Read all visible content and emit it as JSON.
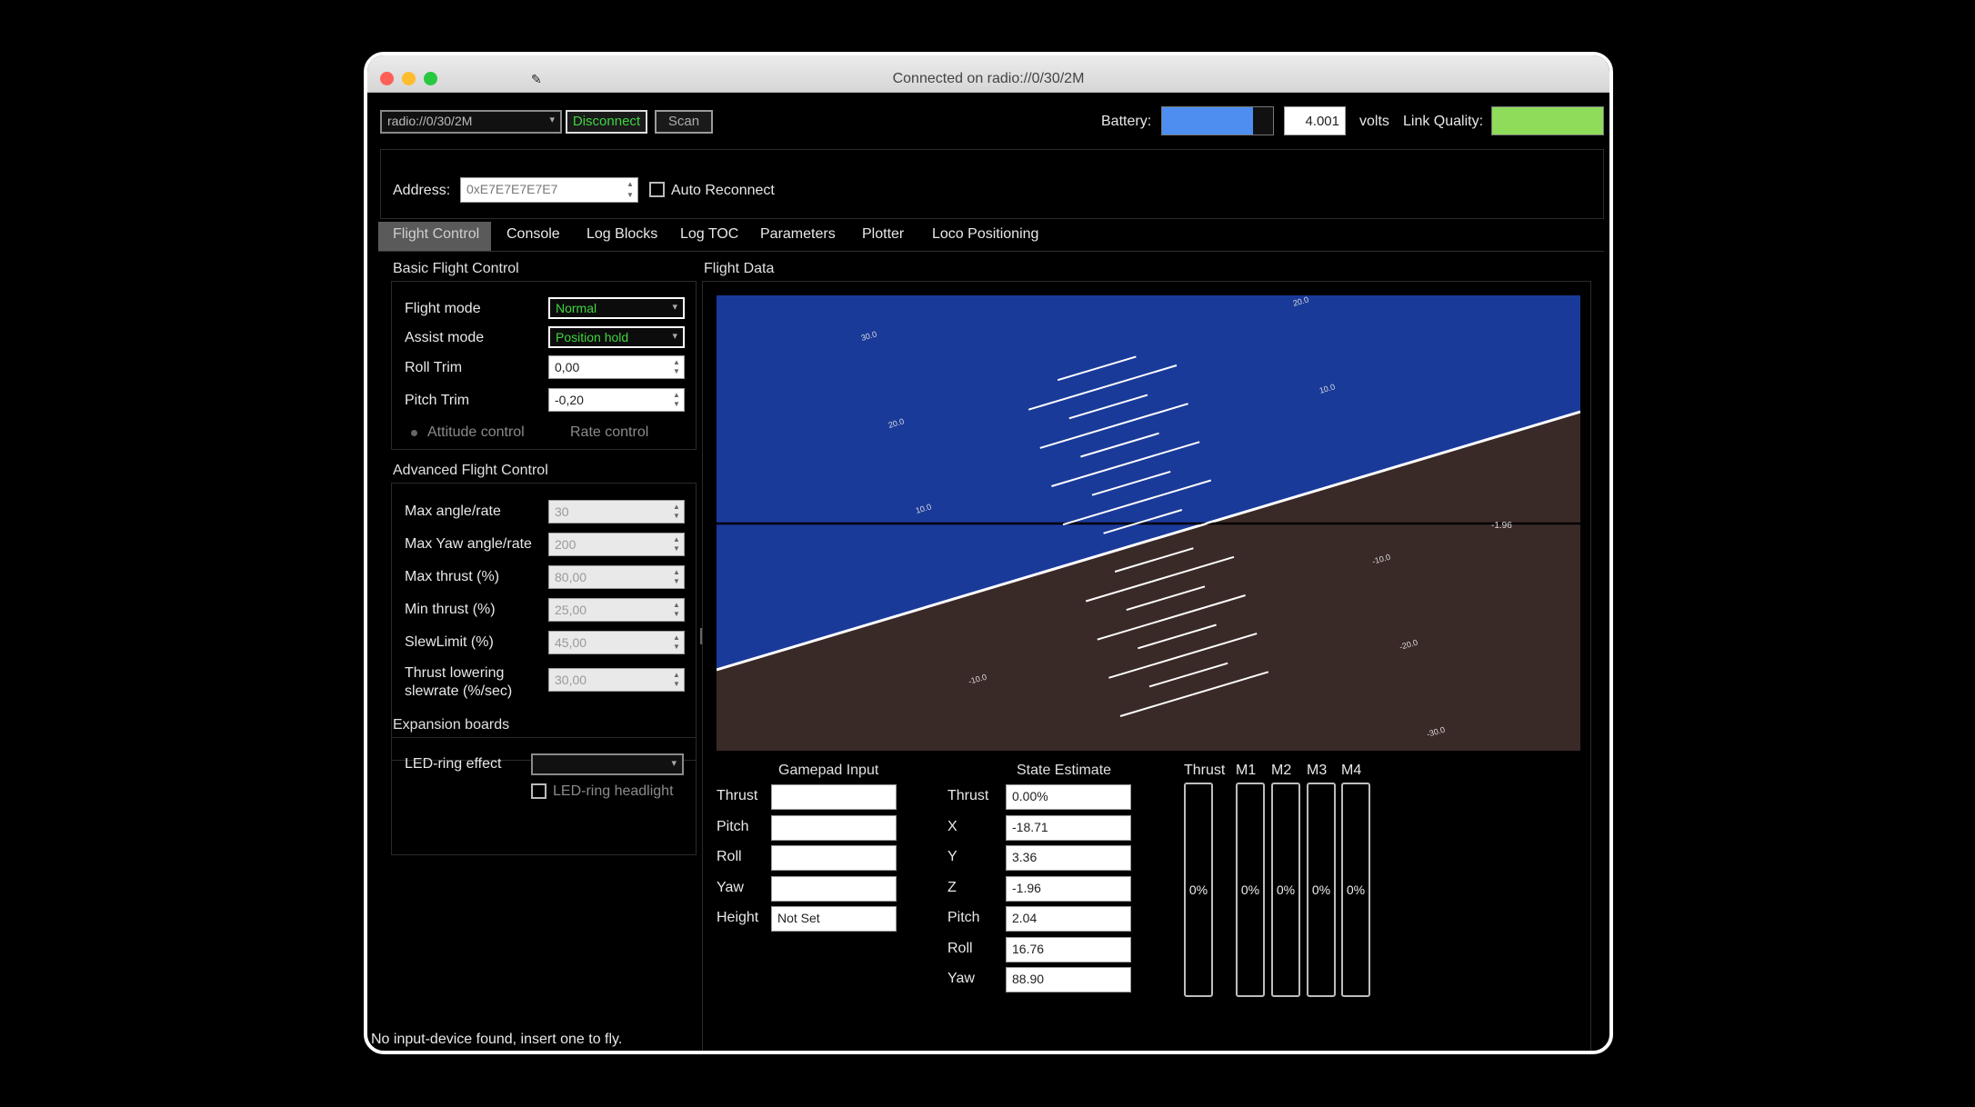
{
  "window": {
    "title": "Connected on radio://0/30/2M"
  },
  "toolbar": {
    "uri_value": "radio://0/30/2M",
    "disconnect_label": "Disconnect",
    "scan_label": "Scan",
    "battery_label": "Battery:",
    "battery_level": 0.82,
    "battery_value": "4.001",
    "volts_label": "volts",
    "link_quality_label": "Link Quality:",
    "link_quality_level": 1.0
  },
  "address": {
    "label": "Address:",
    "value": "0xE7E7E7E7E7",
    "auto_reconnect_label": "Auto Reconnect"
  },
  "tabs": [
    "Flight Control",
    "Console",
    "Log Blocks",
    "Log TOC",
    "Parameters",
    "Plotter",
    "Loco Positioning"
  ],
  "basic": {
    "title": "Basic Flight Control",
    "flight_mode_label": "Flight mode",
    "flight_mode_value": "Normal",
    "assist_mode_label": "Assist mode",
    "assist_mode_value": "Position hold",
    "roll_trim_label": "Roll Trim",
    "roll_trim_value": "0,00",
    "pitch_trim_label": "Pitch Trim",
    "pitch_trim_value": "-0,20",
    "attitude_label": "Attitude control",
    "rate_label": "Rate control"
  },
  "advanced": {
    "title": "Advanced Flight Control",
    "rows": [
      {
        "label": "Max angle/rate",
        "value": "30"
      },
      {
        "label": "Max Yaw angle/rate",
        "value": "200"
      },
      {
        "label": "Max thrust (%)",
        "value": "80,00"
      },
      {
        "label": "Min thrust (%)",
        "value": "25,00"
      },
      {
        "label": "SlewLimit (%)",
        "value": "45,00"
      }
    ],
    "thrust_lowering_line1": "Thrust lowering",
    "thrust_lowering_line2": "slewrate (%/sec)",
    "thrust_lowering_value": "30,00"
  },
  "expansion": {
    "title": "Expansion boards",
    "led_effect_label": "LED-ring effect",
    "led_headlight_label": "LED-ring headlight"
  },
  "flight_data": {
    "title": "Flight Data",
    "horizon": {
      "sky_color": "#1a3a9a",
      "ground_color": "#3a2a27",
      "roll": 16.76,
      "pitch": 2.04,
      "alt_label": "-1.96"
    },
    "pitch_labels_left": [
      "30.0",
      "20.0",
      "10.0",
      "-10.0"
    ],
    "pitch_labels_right": [
      "20.0",
      "10.0",
      "-10.0",
      "-20.0",
      "-30.0"
    ]
  },
  "gamepad": {
    "title": "Gamepad Input",
    "rows": [
      {
        "label": "Thrust",
        "value": ""
      },
      {
        "label": "Pitch",
        "value": ""
      },
      {
        "label": "Roll",
        "value": ""
      },
      {
        "label": "Yaw",
        "value": ""
      },
      {
        "label": "Height",
        "value": "Not Set"
      }
    ]
  },
  "state": {
    "title": "State Estimate",
    "rows": [
      {
        "label": "Thrust",
        "value": "0.00%"
      },
      {
        "label": "X",
        "value": "-18.71"
      },
      {
        "label": "Y",
        "value": "3.36"
      },
      {
        "label": "Z",
        "value": "-1.96"
      },
      {
        "label": "Pitch",
        "value": "2.04"
      },
      {
        "label": "Roll",
        "value": "16.76"
      },
      {
        "label": "Yaw",
        "value": "88.90"
      }
    ]
  },
  "motors": [
    {
      "label": "Thrust",
      "value": "0%"
    },
    {
      "label": "M1",
      "value": "0%"
    },
    {
      "label": "M2",
      "value": "0%"
    },
    {
      "label": "M3",
      "value": "0%"
    },
    {
      "label": "M4",
      "value": "0%"
    }
  ],
  "status_bar": "No input-device found, insert one to fly."
}
